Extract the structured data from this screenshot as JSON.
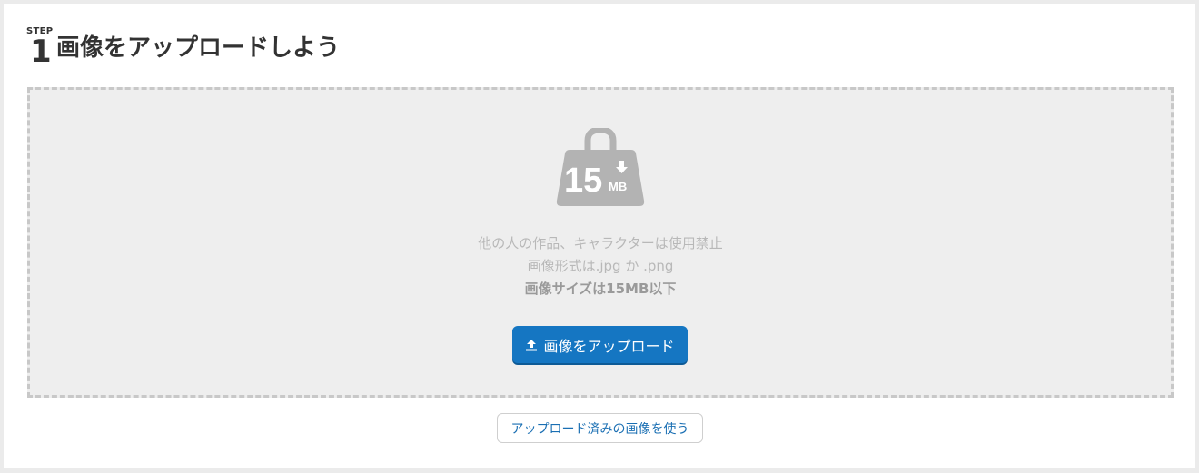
{
  "header": {
    "step_label": "STEP",
    "step_number": "1",
    "title": "画像をアップロードしよう"
  },
  "dropzone": {
    "icon": {
      "name": "weight-15mb-icon",
      "number": "15",
      "unit": "MB"
    },
    "notes": [
      "他の人の作品、キャラクターは使用禁止",
      "画像形式は.jpg か .png",
      "画像サイズは15MB以下"
    ],
    "upload_button": {
      "label": "画像をアップロード",
      "icon": "upload-icon"
    }
  },
  "used_images_button": {
    "label": "アップロード済みの画像を使う"
  },
  "colors": {
    "primary": "#1576c2",
    "dropzone_bg": "#eeeeee",
    "dashed_border": "#c8c8c8",
    "icon_gray": "#b3b3b3",
    "link_text": "#1a6fb3"
  }
}
